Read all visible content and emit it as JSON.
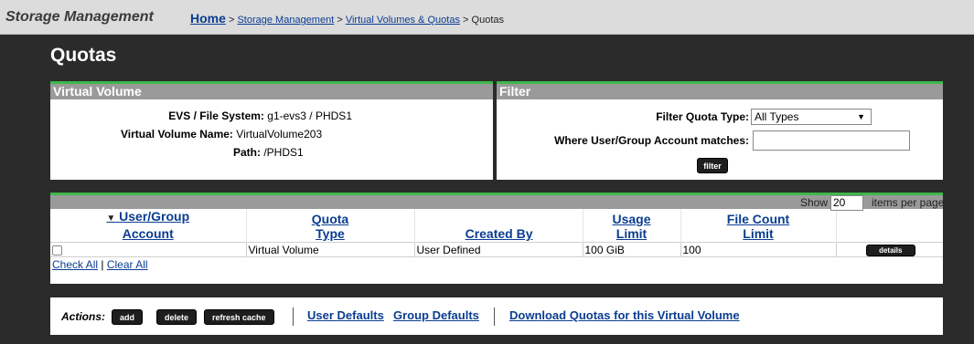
{
  "header": {
    "app_title": "Storage Management",
    "breadcrumb": {
      "home": "Home",
      "items": [
        "Storage Management",
        "Virtual Volumes & Quotas"
      ],
      "current": "Quotas",
      "separator": ">"
    }
  },
  "page_title": "Quotas",
  "virtual_volume": {
    "title": "Virtual Volume",
    "evs_label": "EVS / File System:",
    "evs_value": "g1-evs3 /  PHDS1",
    "name_label": "Virtual Volume Name:",
    "name_value": "VirtualVolume203",
    "path_label": "Path:",
    "path_value": "/PHDS1"
  },
  "filter": {
    "title": "Filter",
    "quota_type_label": "Filter Quota Type:",
    "quota_type_value": "All Types",
    "account_label": "Where User/Group Account matches:",
    "account_value": "",
    "button_label": "filter"
  },
  "table": {
    "show_label": "Show",
    "items_per_page": "20",
    "items_per_page_label": "items per page",
    "columns": [
      "User/Group Account",
      "Quota Type",
      "Created By",
      "Usage Limit",
      "File Count Limit"
    ],
    "column_lines": {
      "account": [
        "User/Group",
        "Account"
      ],
      "quota_type": [
        "Quota",
        "Type"
      ],
      "created_by": [
        "Created By"
      ],
      "usage_limit": [
        "Usage",
        "Limit"
      ],
      "file_count_limit": [
        "File Count",
        "Limit"
      ]
    },
    "sort_indicator": "▼",
    "rows": [
      {
        "account": "",
        "quota_type": "Virtual Volume",
        "created_by": "User Defined",
        "usage_limit": "100 GiB",
        "file_count_limit": "100",
        "action": "details"
      }
    ],
    "check_all": "Check All",
    "clear_all": "Clear All",
    "divider": "|"
  },
  "actions": {
    "label": "Actions:",
    "buttons": [
      "add",
      "delete",
      "refresh cache"
    ],
    "links": [
      "User Defaults",
      "Group Defaults",
      "Download Quotas for this Virtual Volume"
    ]
  },
  "colors": {
    "accent_green": "#3fb84a",
    "header_gray": "#9a9a9a",
    "background": "#2b2b2b",
    "link_blue": "#0a3d91"
  }
}
